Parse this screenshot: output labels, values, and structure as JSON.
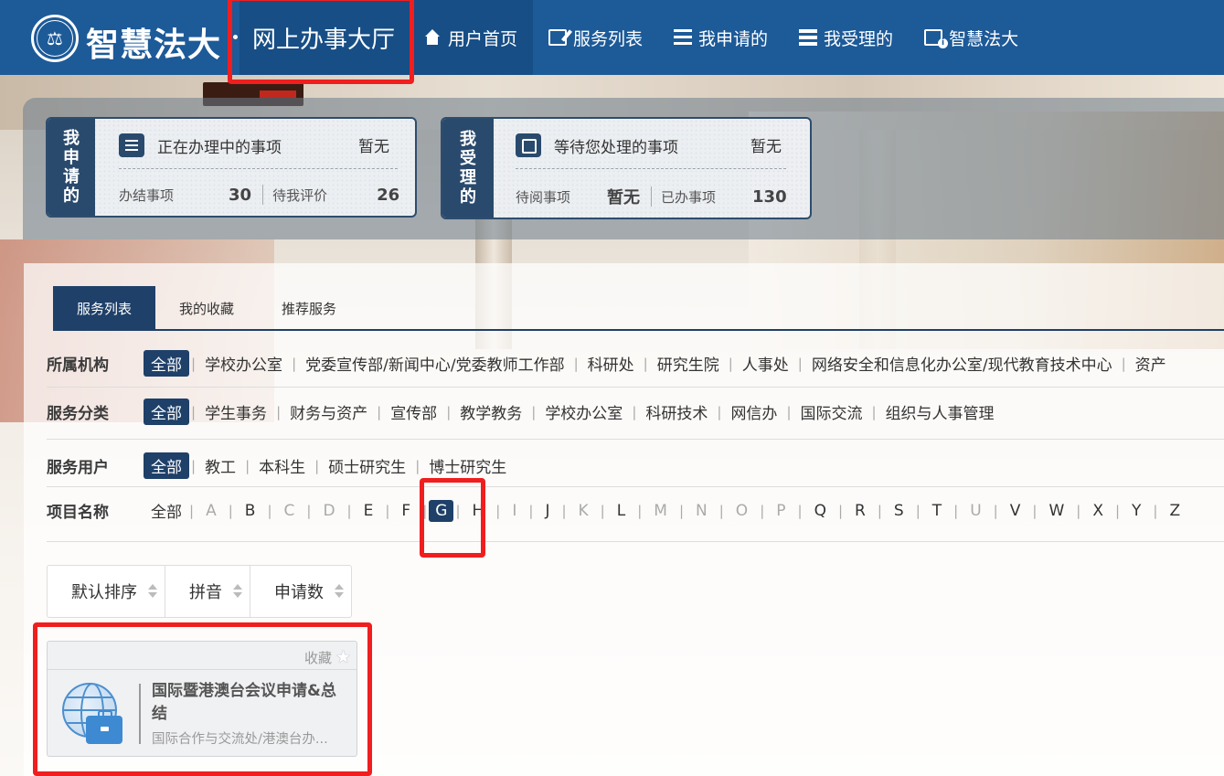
{
  "header": {
    "brand": "智慧法大",
    "hall": "网上办事大厅",
    "nav": [
      {
        "label": "用户首页",
        "icon": "home-icon"
      },
      {
        "label": "服务列表",
        "icon": "edit-icon"
      },
      {
        "label": "我申请的",
        "icon": "list-icon"
      },
      {
        "label": "我受理的",
        "icon": "server-icon"
      },
      {
        "label": "智慧法大",
        "icon": "info-doc-icon"
      }
    ]
  },
  "applied": {
    "side": "我申请的",
    "title": "正在办理中的事项",
    "status": "暂无",
    "done_label": "办结事项",
    "done_value": "30",
    "eval_label": "待我评价",
    "eval_value": "26"
  },
  "accepted": {
    "side": "我受理的",
    "title": "等待您处理的事项",
    "status": "暂无",
    "read_label": "待阅事项",
    "read_value": "暂无",
    "handled_label": "已办事项",
    "handled_value": "130"
  },
  "tabs": [
    "服务列表",
    "我的收藏",
    "推荐服务"
  ],
  "filters": {
    "org": {
      "label": "所属机构",
      "options": [
        "全部",
        "学校办公室",
        "党委宣传部/新闻中心/党委教师工作部",
        "科研处",
        "研究生院",
        "人事处",
        "网络安全和信息化办公室/现代教育技术中心",
        "资产"
      ]
    },
    "category": {
      "label": "服务分类",
      "options": [
        "全部",
        "学生事务",
        "财务与资产",
        "宣传部",
        "教学教务",
        "学校办公室",
        "科研技术",
        "网信办",
        "国际交流",
        "组织与人事管理"
      ]
    },
    "user": {
      "label": "服务用户",
      "options": [
        "全部",
        "教工",
        "本科生",
        "硕士研究生",
        "博士研究生"
      ]
    },
    "name": {
      "label": "项目名称",
      "all": "全部",
      "letters": [
        "A",
        "B",
        "C",
        "D",
        "E",
        "F",
        "G",
        "H",
        "I",
        "J",
        "K",
        "L",
        "M",
        "N",
        "O",
        "P",
        "Q",
        "R",
        "S",
        "T",
        "U",
        "V",
        "W",
        "X",
        "Y",
        "Z"
      ],
      "selected": "G",
      "dim": [
        "A",
        "C",
        "D",
        "I",
        "K",
        "M",
        "N",
        "O",
        "P",
        "U"
      ]
    }
  },
  "sort": [
    "默认排序",
    "拼音",
    "申请数"
  ],
  "service": {
    "fav_label": "收藏",
    "title": "国际暨港澳台会议申请&总结",
    "dept": "国际合作与交流处/港澳台办..."
  }
}
